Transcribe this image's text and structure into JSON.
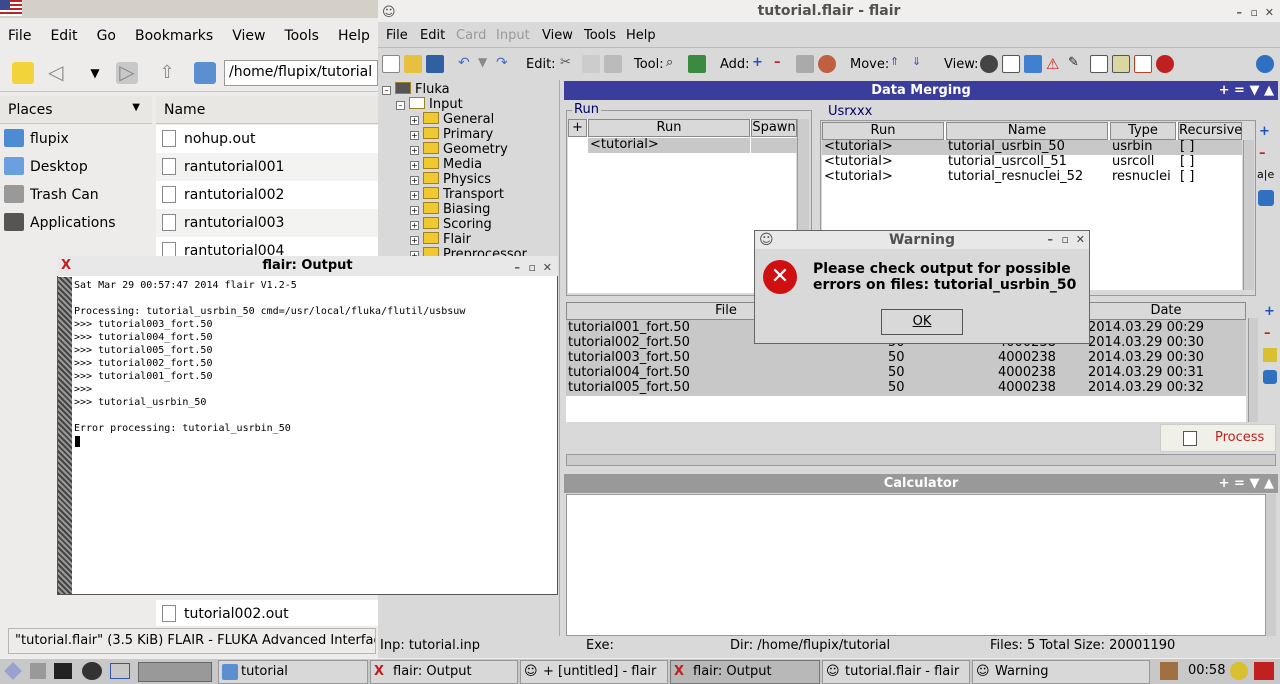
{
  "filemanager": {
    "menu": [
      "File",
      "Edit",
      "Go",
      "Bookmarks",
      "View",
      "Tools",
      "Help"
    ],
    "path": "/home/flupix/tutorial",
    "places_label": "Places",
    "places": [
      "flupix",
      "Desktop",
      "Trash Can",
      "Applications"
    ],
    "name_header": "Name",
    "files": [
      "nohup.out",
      "rantutorial001",
      "rantutorial002",
      "rantutorial003",
      "rantutorial004"
    ],
    "file_bottom": "tutorial002.out",
    "status": "\"tutorial.flair\" (3.5 KiB) FLAIR - FLUKA Advanced Interface"
  },
  "flair": {
    "title": "tutorial.flair - flair",
    "menu": [
      "File",
      "Edit",
      "Card",
      "Input",
      "View",
      "Tools",
      "Help"
    ],
    "toolbar": {
      "edit": "Edit:",
      "tool": "Tool:",
      "add": "Add:",
      "move": "Move:",
      "view": "View:"
    },
    "tree": {
      "root": "Fluka",
      "input": "Input",
      "items": [
        "General",
        "Primary",
        "Geometry",
        "Media",
        "Physics",
        "Transport",
        "Biasing",
        "Scoring",
        "Flair",
        "Preprocessor"
      ]
    },
    "merging": {
      "header": "Data Merging",
      "header_ctrl": "+ = ▼ ▲",
      "run_group": "Run",
      "run_cols": [
        "+",
        "Run",
        "Spawn"
      ],
      "run_rows": [
        "<tutorial>"
      ],
      "usr_group": "Usrxxx",
      "usr_cols": [
        "Run",
        "Name",
        "Type",
        "Recursive"
      ],
      "usr_rows": [
        {
          "run": "<tutorial>",
          "name": "tutorial_usrbin_50",
          "type": "usrbin",
          "rec": "[ ]"
        },
        {
          "run": "<tutorial>",
          "name": "tutorial_usrcoll_51",
          "type": "usrcoll",
          "rec": "[ ]"
        },
        {
          "run": "<tutorial>",
          "name": "tutorial_resnuclei_52",
          "type": "resnuclei",
          "rec": "[ ]"
        }
      ],
      "file_cols": [
        "File",
        "",
        "",
        "Date"
      ],
      "file_rows": [
        {
          "file": "tutorial001_fort.50",
          "u": "",
          "s": "",
          "date": "2014.03.29 00:29"
        },
        {
          "file": "tutorial002_fort.50",
          "u": "50",
          "s": "4000238",
          "date": "2014.03.29 00:30"
        },
        {
          "file": "tutorial003_fort.50",
          "u": "50",
          "s": "4000238",
          "date": "2014.03.29 00:30"
        },
        {
          "file": "tutorial004_fort.50",
          "u": "50",
          "s": "4000238",
          "date": "2014.03.29 00:31"
        },
        {
          "file": "tutorial005_fort.50",
          "u": "50",
          "s": "4000238",
          "date": "2014.03.29 00:32"
        }
      ],
      "process": "Process"
    },
    "calculator": "Calculator",
    "status": {
      "inp": "Inp: tutorial.inp",
      "exe": "Exe:",
      "dir": "Dir: /home/flupix/tutorial",
      "files": "Files: 5 Total Size: 20001190"
    }
  },
  "output": {
    "title": "flair: Output",
    "text": "Sat Mar 29 00:57:47 2014 flair V1.2-5\n\nProcessing: tutorial_usrbin_50 cmd=/usr/local/fluka/flutil/usbsuw\n>>> tutorial003_fort.50\n>>> tutorial004_fort.50\n>>> tutorial005_fort.50\n>>> tutorial002_fort.50\n>>> tutorial001_fort.50\n>>>\n>>> tutorial_usrbin_50\n\nError processing: tutorial_usrbin_50"
  },
  "warning": {
    "title": "Warning",
    "message_line1": "Please check output for possible",
    "message_line2": "errors on files: tutorial_usrbin_50",
    "ok": "OK"
  },
  "taskbar": {
    "tasks": [
      "tutorial",
      "flair: Output",
      "+ [untitled] - flair",
      "flair: Output",
      "tutorial.flair - flair",
      "Warning"
    ],
    "clock": "00:58"
  },
  "colors": {
    "panel_header": "#3a3d9c",
    "error_red": "#d01010"
  }
}
